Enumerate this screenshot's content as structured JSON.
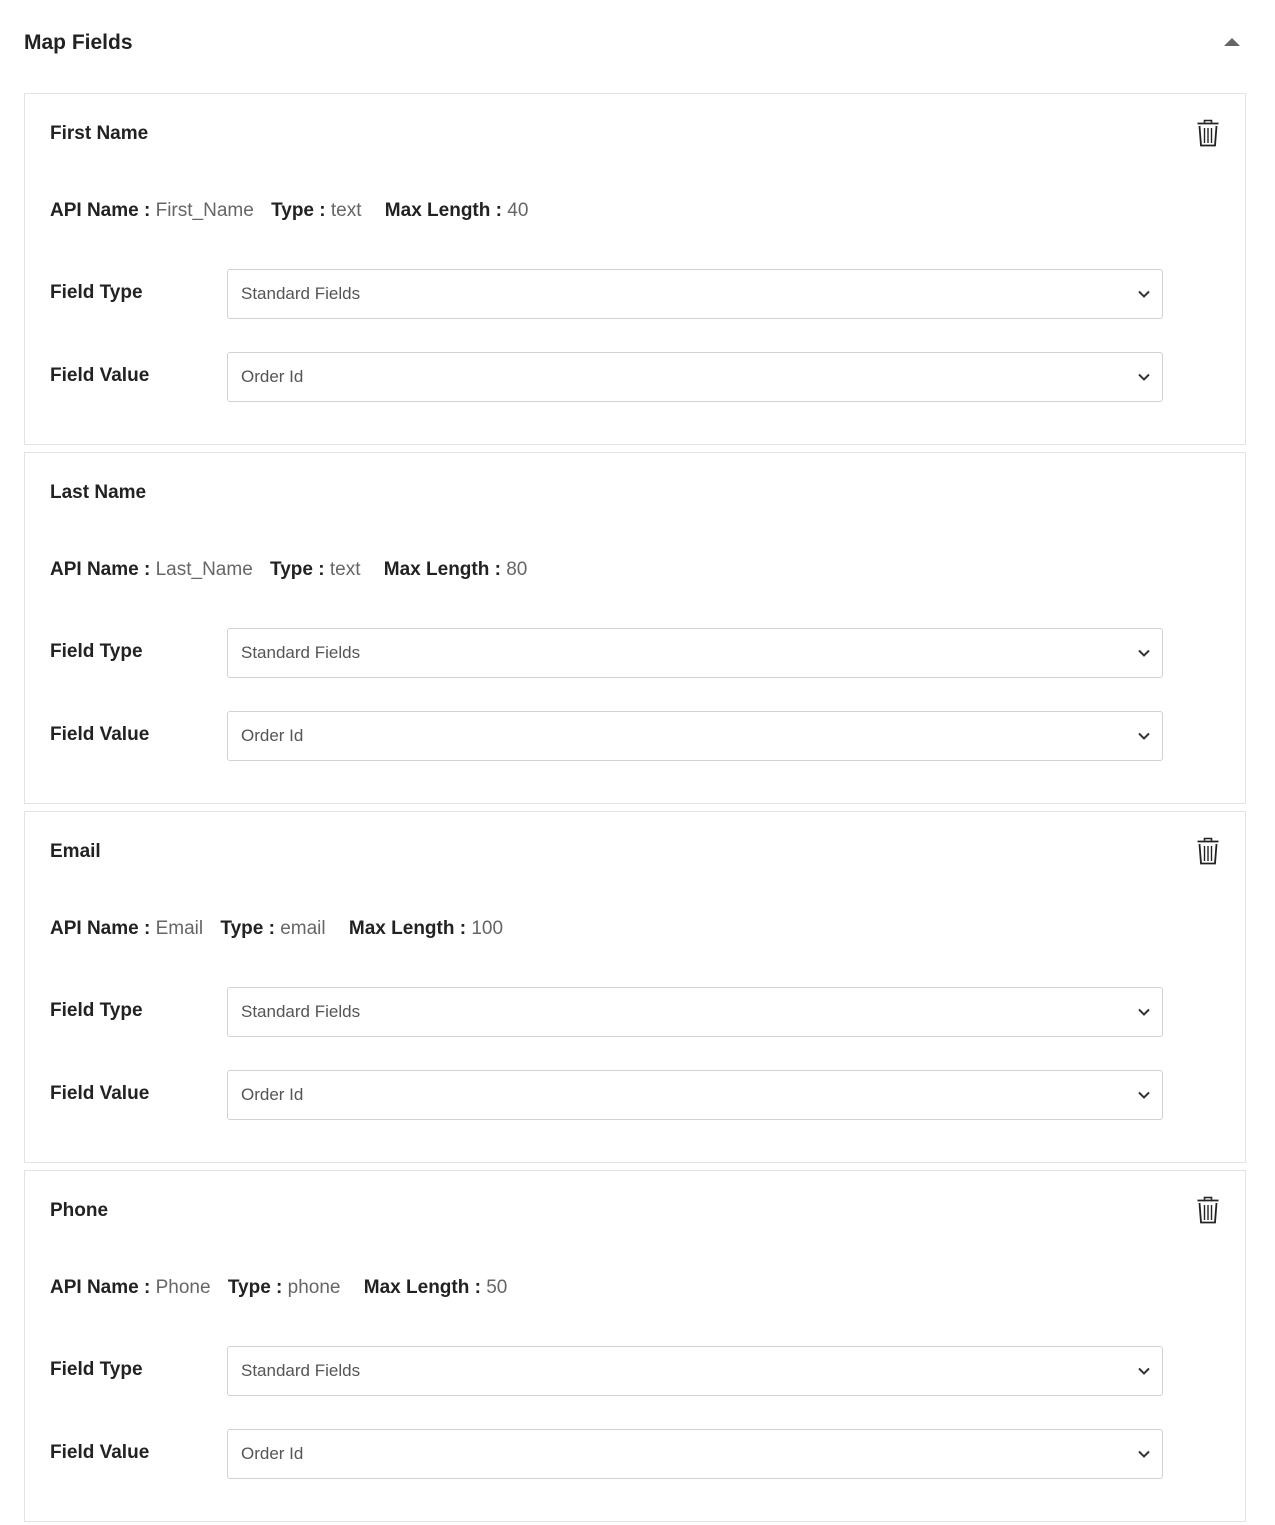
{
  "section": {
    "title": "Map Fields",
    "collapse_icon": "caret-up-icon"
  },
  "labels": {
    "api_name": "API Name :",
    "type": "Type :",
    "max_length": "Max Length :",
    "field_type": "Field Type",
    "field_value": "Field Value"
  },
  "fields": [
    {
      "title": "First Name",
      "api_name": "First_Name",
      "type": "text",
      "max_length": "40",
      "field_type": "Standard Fields",
      "field_value": "Order Id",
      "deletable": true
    },
    {
      "title": "Last Name",
      "api_name": "Last_Name",
      "type": "text",
      "max_length": "80",
      "field_type": "Standard Fields",
      "field_value": "Order Id",
      "deletable": false
    },
    {
      "title": "Email",
      "api_name": "Email",
      "type": "email",
      "max_length": "100",
      "field_type": "Standard Fields",
      "field_value": "Order Id",
      "deletable": true
    },
    {
      "title": "Phone",
      "api_name": "Phone",
      "type": "phone",
      "max_length": "50",
      "field_type": "Standard Fields",
      "field_value": "Order Id",
      "deletable": true
    }
  ]
}
